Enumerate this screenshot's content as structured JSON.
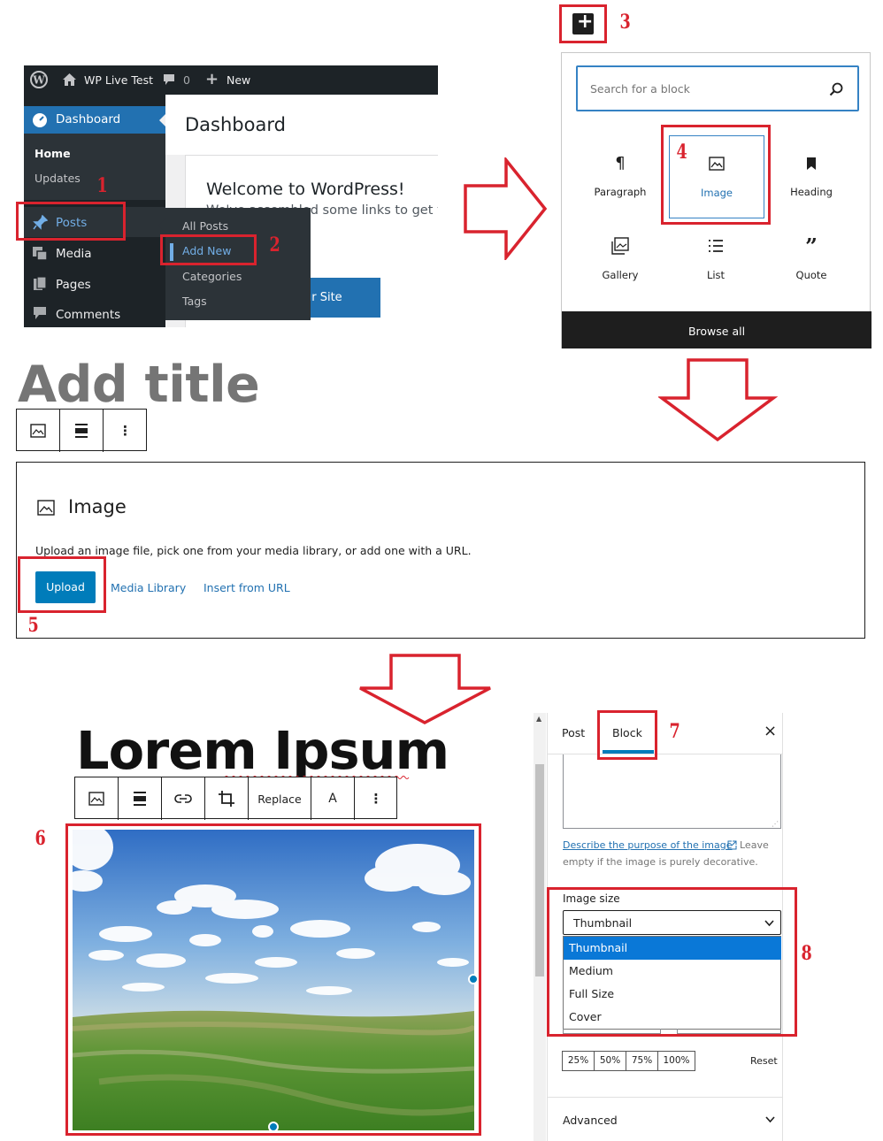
{
  "admin": {
    "topbar": {
      "site_name": "WP Live Test",
      "comments_count": "0",
      "new_label": "New"
    },
    "sidebar": {
      "dashboard": "Dashboard",
      "home": "Home",
      "updates": "Updates",
      "posts": "Posts",
      "media": "Media",
      "pages": "Pages",
      "comments": "Comments"
    },
    "main": {
      "title": "Dashboard",
      "welcome": "Welcome to WordPress!",
      "welcome_text": "We've assembled some links to get yo",
      "button_fragment": "ur Site"
    },
    "flyout": [
      "All Posts",
      "Add New",
      "Categories",
      "Tags"
    ]
  },
  "inserter": {
    "search_placeholder": "Search for a block",
    "blocks": [
      {
        "label": "Paragraph",
        "icon": "paragraph-icon"
      },
      {
        "label": "Image",
        "icon": "image-icon"
      },
      {
        "label": "Heading",
        "icon": "heading-icon"
      },
      {
        "label": "Gallery",
        "icon": "gallery-icon"
      },
      {
        "label": "List",
        "icon": "list-icon"
      },
      {
        "label": "Quote",
        "icon": "quote-icon"
      }
    ],
    "browse_all": "Browse all"
  },
  "editor_placeholder": {
    "add_title": "Add title",
    "block_title": "Image",
    "instructions": "Upload an image file, pick one from your media library, or add one with a URL.",
    "upload": "Upload",
    "media_library": "Media Library",
    "insert_from_url": "Insert from URL"
  },
  "editor_filled": {
    "post_title": "Lorem Ipsum",
    "toolbar_replace": "Replace",
    "toolbar_text": "A"
  },
  "block_sidebar": {
    "tab_post": "Post",
    "tab_block": "Block",
    "close": "×",
    "alt_link": "Describe the purpose of the image",
    "alt_help_1": "Leave",
    "alt_help_2": "empty if the image is purely decorative.",
    "image_size_label": "Image size",
    "image_size_value": "Thumbnail",
    "image_size_options": [
      "Thumbnail",
      "Medium",
      "Full Size",
      "Cover"
    ],
    "percent_buttons": [
      "25%",
      "50%",
      "75%",
      "100%"
    ],
    "reset": "Reset",
    "advanced": "Advanced"
  },
  "step_numbers": [
    "1",
    "2",
    "3",
    "4",
    "5",
    "6",
    "7",
    "8"
  ],
  "colors": {
    "annotation_red": "#d9232e",
    "wp_blue": "#2271b1",
    "admin_dark": "#1d2327",
    "link_blue": "#2271b1",
    "select_highlight": "#0a78d7"
  }
}
